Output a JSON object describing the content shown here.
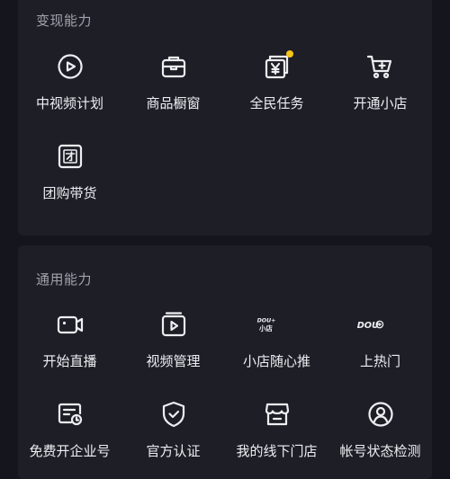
{
  "monetize": {
    "title": "变现能力",
    "items": [
      {
        "label": "中视频计划",
        "icon": "play-circle-icon"
      },
      {
        "label": "商品橱窗",
        "icon": "briefcase-icon"
      },
      {
        "label": "全民任务",
        "icon": "yuan-card-icon",
        "badge_color": "#f5c518"
      },
      {
        "label": "开通小店",
        "icon": "cart-plus-icon"
      },
      {
        "label": "团购带货",
        "icon": "group-buy-icon"
      }
    ]
  },
  "general": {
    "title": "通用能力",
    "items": [
      {
        "label": "开始直播",
        "icon": "video-camera-icon"
      },
      {
        "label": "视频管理",
        "icon": "video-manage-icon"
      },
      {
        "label": "小店随心推",
        "icon": "dou-shop-logo-icon",
        "logo_top": "DOU+",
        "logo_bottom": "小店"
      },
      {
        "label": "上热门",
        "icon": "dou-plus-logo-icon",
        "logo_text": "DOU"
      },
      {
        "label": "免费开企业号",
        "icon": "enterprise-card-icon"
      },
      {
        "label": "官方认证",
        "icon": "shield-check-icon"
      },
      {
        "label": "我的线下门店",
        "icon": "storefront-icon"
      },
      {
        "label": "帐号状态检测",
        "icon": "account-check-icon"
      }
    ]
  },
  "colors": {
    "background": "#15151d",
    "card": "#1e1e27",
    "section_title": "#a2a2ab",
    "text": "#eeeef2",
    "badge": "#f5c518"
  }
}
